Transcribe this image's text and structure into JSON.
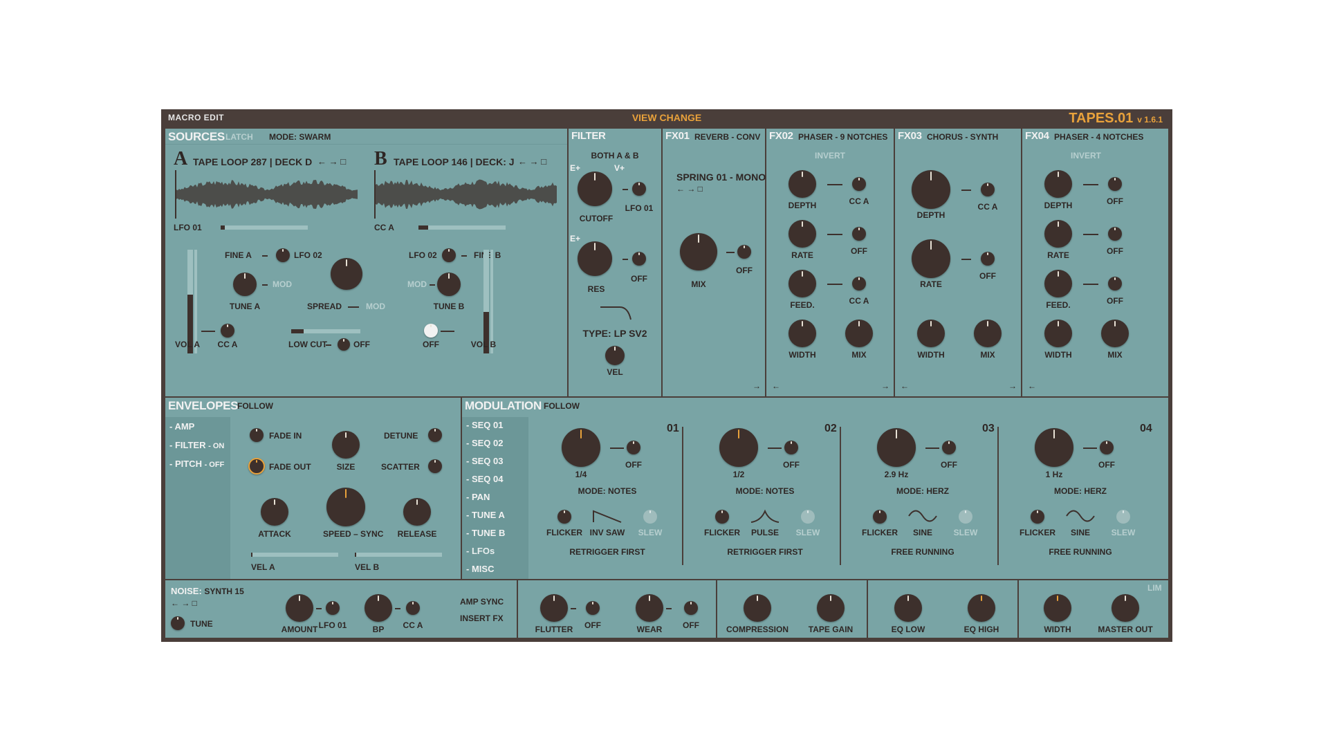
{
  "topbar": {
    "macro_edit": "MACRO EDIT",
    "view_change": "VIEW CHANGE",
    "app_name": "TAPES.01",
    "version": "v 1.6.1"
  },
  "sources": {
    "title": "SOURCES",
    "latch": "LATCH",
    "mode": "MODE: SWARM",
    "a": {
      "letter": "A",
      "name": "TAPE LOOP 287 | DECK D",
      "mod_label": "LFO 01"
    },
    "b": {
      "letter": "B",
      "name": "TAPE LOOP 146 | DECK: J",
      "mod_label": "CC A"
    },
    "fine_a": "FINE A",
    "lfo02_a": "LFO 02",
    "lfo02_b": "LFO 02",
    "fine_b": "FINE B",
    "tune_a": "TUNE A",
    "mod_a": "MOD",
    "spread": "SPREAD",
    "mod_spread": "MOD",
    "mod_b": "MOD",
    "tune_b": "TUNE B",
    "vol_a": "VOL A",
    "cc_a": "CC A",
    "low_cut": "LOW CUT",
    "low_cut_mod": "OFF",
    "off_b": "OFF",
    "vol_b": "VOL B",
    "vol_a_level": 0.57,
    "vol_b_level": 0.4
  },
  "filter": {
    "title": "FILTER",
    "target": "BOTH A & B",
    "e_plus_1": "E+",
    "v_plus": "V+",
    "cutoff": "CUTOFF",
    "lfo01": "LFO 01",
    "e_plus_2": "E+",
    "res": "RES",
    "res_mod": "OFF",
    "type": "TYPE: LP SV2",
    "vel": "VEL"
  },
  "fx01": {
    "title": "FX01",
    "sub": "REVERB - CONV",
    "preset": "SPRING 01 - MONO",
    "mix": "MIX",
    "mix_mod": "OFF"
  },
  "fx02": {
    "title": "FX02",
    "sub": "PHASER - 9 NOTCHES",
    "invert": "INVERT",
    "depth": "DEPTH",
    "depth_mod": "CC A",
    "rate": "RATE",
    "rate_mod": "OFF",
    "feed": "FEED.",
    "feed_mod": "CC A",
    "width": "WIDTH",
    "mix": "MIX"
  },
  "fx03": {
    "title": "FX03",
    "sub": "CHORUS - SYNTH",
    "depth": "DEPTH",
    "depth_mod": "CC A",
    "rate": "RATE",
    "rate_mod": "OFF",
    "width": "WIDTH",
    "mix": "MIX"
  },
  "fx04": {
    "title": "FX04",
    "sub": "PHASER - 4 NOTCHES",
    "invert": "INVERT",
    "depth": "DEPTH",
    "depth_mod": "OFF",
    "rate": "RATE",
    "rate_mod": "OFF",
    "feed": "FEED.",
    "feed_mod": "OFF",
    "width": "WIDTH",
    "mix": "MIX"
  },
  "envelopes": {
    "title": "ENVELOPES",
    "follow": "FOLLOW",
    "items": [
      {
        "label": "AMP",
        "state": ""
      },
      {
        "label": "FILTER",
        "state": "- ON"
      },
      {
        "label": "PITCH",
        "state": "- OFF"
      }
    ],
    "fade_in": "FADE IN",
    "detune": "DETUNE",
    "size": "SIZE",
    "fade_out": "FADE OUT",
    "scatter": "SCATTER",
    "attack": "ATTACK",
    "speed": "SPEED",
    "sync": "SYNC",
    "release": "RELEASE",
    "vel_a": "VEL A",
    "vel_b": "VEL B"
  },
  "modulation": {
    "title": "MODULATION",
    "follow": "FOLLOW",
    "items": [
      "SEQ 01",
      "SEQ 02",
      "SEQ 03",
      "SEQ 04",
      "PAN",
      "TUNE A",
      "TUNE B",
      "LFOs",
      "MISC"
    ],
    "lfos": [
      {
        "num": "01",
        "rate": "1/4",
        "mod": "OFF",
        "mode": "MODE: NOTES",
        "flicker": "FLICKER",
        "shape": "INV SAW",
        "slew": "SLEW",
        "trigger": "RETRIGGER FIRST"
      },
      {
        "num": "02",
        "rate": "1/2",
        "mod": "OFF",
        "mode": "MODE: NOTES",
        "flicker": "FLICKER",
        "shape": "PULSE",
        "slew": "SLEW",
        "trigger": "RETRIGGER FIRST"
      },
      {
        "num": "03",
        "rate": "2.9 Hz",
        "mod": "OFF",
        "mode": "MODE: HERZ",
        "flicker": "FLICKER",
        "shape": "SINE",
        "slew": "SLEW",
        "trigger": "FREE RUNNING"
      },
      {
        "num": "04",
        "rate": "1 Hz",
        "mod": "OFF",
        "mode": "MODE: HERZ",
        "flicker": "FLICKER",
        "shape": "SINE",
        "slew": "SLEW",
        "trigger": "FREE RUNNING"
      }
    ]
  },
  "bottom": {
    "noise_label": "NOISE:",
    "noise_value": "SYNTH 15",
    "tune": "TUNE",
    "amount": "AMOUNT",
    "lfo01": "LFO 01",
    "bp": "BP",
    "cc_a": "CC A",
    "amp_sync": "AMP SYNC",
    "insert_fx": "INSERT FX",
    "flutter": "FLUTTER",
    "flutter_mod": "OFF",
    "wear": "WEAR",
    "wear_mod": "OFF",
    "compression": "COMPRESSION",
    "tape_gain": "TAPE GAIN",
    "eq_low": "EQ LOW",
    "eq_high": "EQ HIGH",
    "width": "WIDTH",
    "master_out": "MASTER OUT",
    "lim": "LIM"
  },
  "icons": {
    "arrows": "← → □",
    "left_arrow": "←",
    "right_arrow": "→"
  },
  "colors": {
    "panel": "#79a4a5",
    "frame": "#4a3e3a",
    "accent": "#e9a23b",
    "knob": "#3d302c"
  }
}
